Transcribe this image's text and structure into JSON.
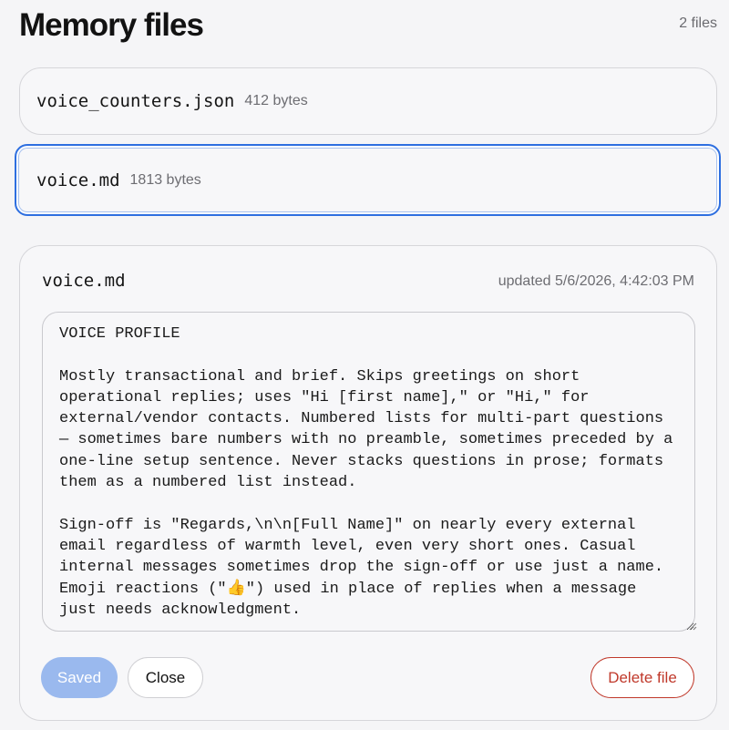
{
  "header": {
    "title": "Memory files",
    "count": "2 files"
  },
  "files": [
    {
      "name": "voice_counters.json",
      "size": "412 bytes"
    },
    {
      "name": "voice.md",
      "size": "1813 bytes"
    }
  ],
  "editor": {
    "filename": "voice.md",
    "updated": "updated 5/6/2026, 4:42:03 PM",
    "content": "VOICE PROFILE\n\nMostly transactional and brief. Skips greetings on short operational replies; uses \"Hi [first name],\" or \"Hi,\" for external/vendor contacts. Numbered lists for multi-part questions — sometimes bare numbers with no preamble, sometimes preceded by a one-line setup sentence. Never stacks questions in prose; formats them as a numbered list instead.\n\nSign-off is \"Regards,\\n\\n[Full Name]\" on nearly every external email regardless of warmth level, even very short ones. Casual internal messages sometimes drop the sign-off or use just a name. Emoji reactions (\"👍\") used in place of replies when a message just needs acknowledgment.",
    "buttons": {
      "saved": "Saved",
      "close": "Close",
      "delete": "Delete file"
    }
  },
  "colors": {
    "accent": "#2e6fe0",
    "saved_button": "#9ab9ee",
    "danger": "#c0392b"
  },
  "icons": {
    "resize": "resize-grip-icon"
  }
}
